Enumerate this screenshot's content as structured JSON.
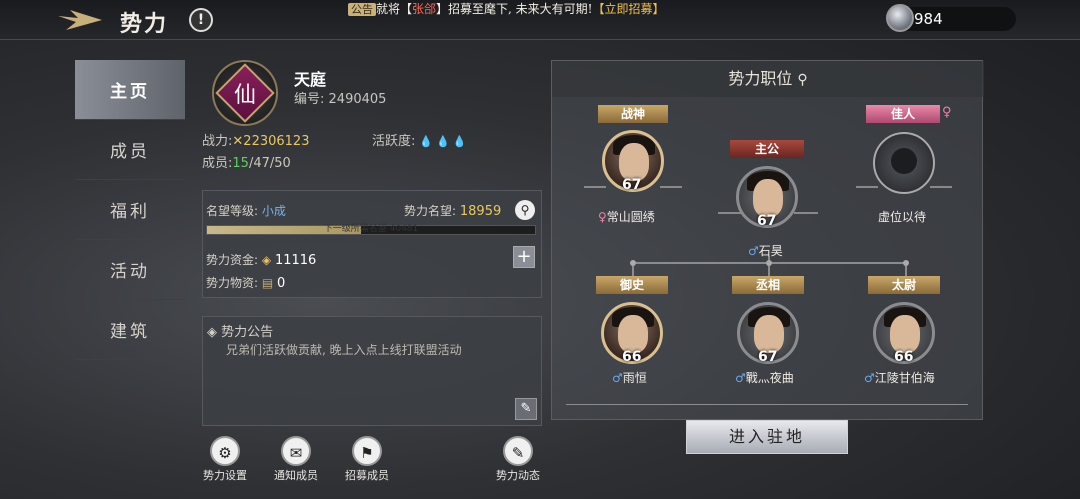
{
  "header": {
    "title": "势力",
    "info_icon": "!",
    "marquee": {
      "tag": "公告",
      "pre": "就将【",
      "name": "张郃",
      "mid": "】招募至麾下, 未来大有可期!",
      "action": "【立即招募】"
    },
    "currency": {
      "icon": "silver-coin-icon",
      "value": "984"
    }
  },
  "sidebar": {
    "items": [
      {
        "label": "主页",
        "active": true
      },
      {
        "label": "成员"
      },
      {
        "label": "福利"
      },
      {
        "label": "活动"
      },
      {
        "label": "建筑"
      }
    ]
  },
  "faction": {
    "emblem_char": "仙",
    "name": "天庭",
    "id_label": "编号:",
    "id": "2490405",
    "power_label": "战力:",
    "power": "22306123",
    "activity_label": "活跃度:",
    "activity": "💧💧💧",
    "members_label": "成员:",
    "members_online": "15",
    "members_total": "/47/50"
  },
  "reputation": {
    "level_label": "名望等级:",
    "level": "小成",
    "points_label": "势力名望:",
    "points": "18959",
    "bar_text": "下一级所需名望 40481",
    "bar_fill": 0.47,
    "funds_label": "势力资金:",
    "funds": "11116",
    "materials_label": "势力物资:",
    "materials": "0"
  },
  "notice": {
    "title": "势力公告",
    "body": "兄弟们活跃做贡献, 晚上入点上线打联盟活动"
  },
  "bottom_actions": [
    {
      "label": "势力设置",
      "icon": "gear-icon",
      "glyph": "⚙"
    },
    {
      "label": "通知成员",
      "icon": "envelope-icon",
      "glyph": "✉"
    },
    {
      "label": "招募成员",
      "icon": "recruit-icon",
      "glyph": "⚑"
    },
    {
      "label": "势力动态",
      "icon": "document-icon",
      "glyph": "✎"
    }
  ],
  "positions": {
    "title": "势力职位",
    "slots": [
      {
        "role": "战神",
        "level": "67",
        "gender": "♀",
        "name": "常山圆绣"
      },
      {
        "role": "主公",
        "level": "67",
        "gender": "♂",
        "name": "石昊"
      },
      {
        "role": "佳人",
        "gender": "♀",
        "name": "虚位以待"
      },
      {
        "role": "御史",
        "level": "66",
        "gender": "♂",
        "name": "雨恒"
      },
      {
        "role": "丞相",
        "level": "67",
        "gender": "♂",
        "name": "戰灬夜曲"
      },
      {
        "role": "太尉",
        "level": "66",
        "gender": "♂",
        "name": "江陵甘伯海"
      }
    ]
  },
  "enter_button": "进入驻地"
}
